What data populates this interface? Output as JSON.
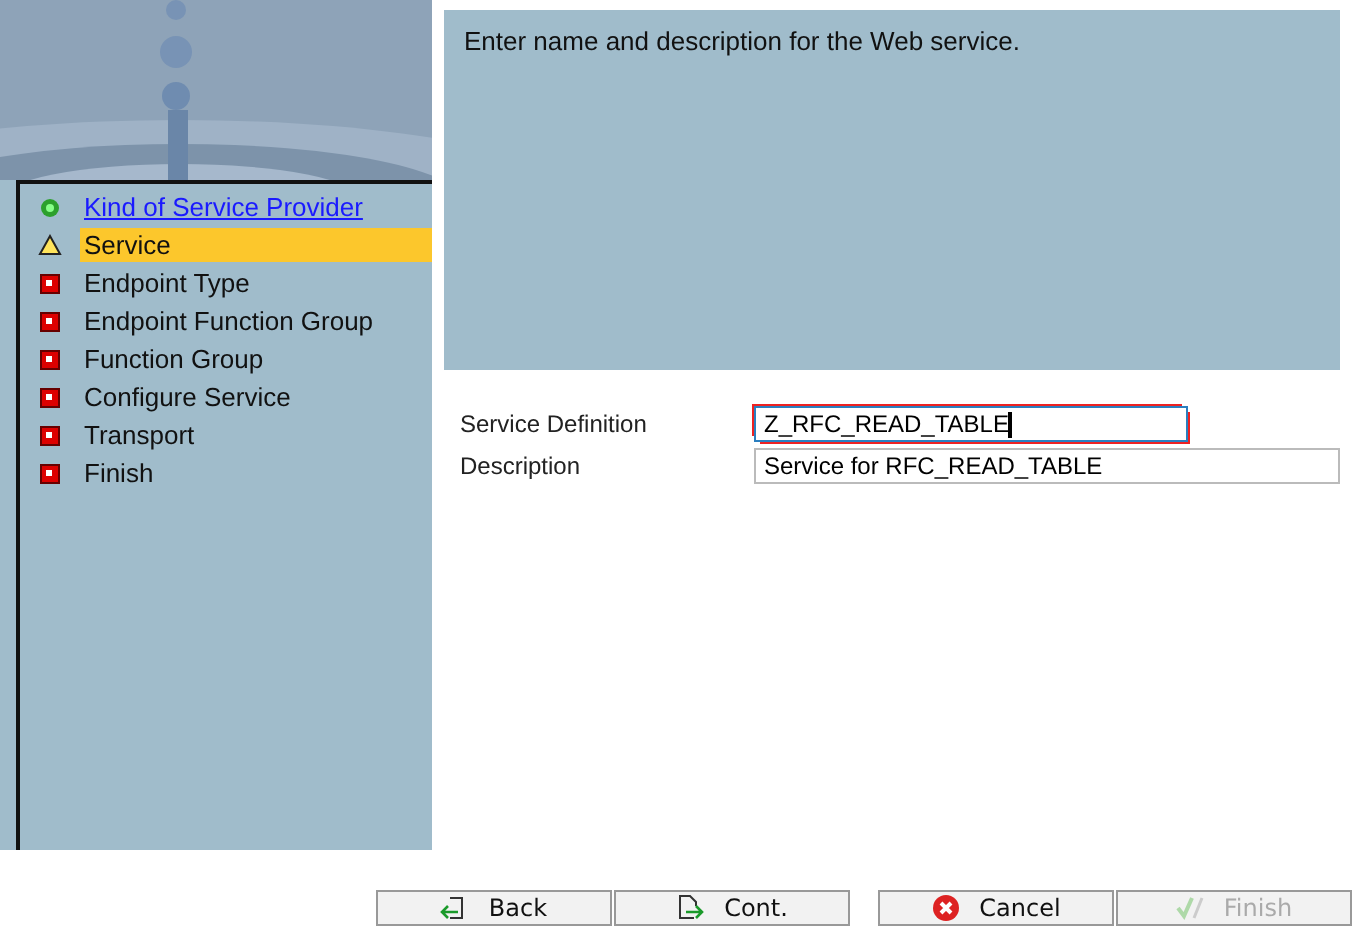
{
  "steps": [
    {
      "label": "Kind of Service Provider",
      "kind": "done",
      "selected": false
    },
    {
      "label": "Service",
      "kind": "current",
      "selected": true
    },
    {
      "label": "Endpoint Type",
      "kind": "todo",
      "selected": false
    },
    {
      "label": "Endpoint Function Group",
      "kind": "todo",
      "selected": false
    },
    {
      "label": "Function Group",
      "kind": "todo",
      "selected": false
    },
    {
      "label": "Configure Service",
      "kind": "todo",
      "selected": false
    },
    {
      "label": "Transport",
      "kind": "todo",
      "selected": false
    },
    {
      "label": "Finish",
      "kind": "todo",
      "selected": false
    }
  ],
  "info": "Enter name and description for the Web service.",
  "fields": [
    {
      "label": "Service Definition",
      "value": "Z_RFC_READ_TABLE",
      "focused": true
    },
    {
      "label": "Description",
      "value": "Service for RFC_READ_TABLE",
      "focused": false
    }
  ],
  "buttons": [
    {
      "kind": "back",
      "label": "Back",
      "disabled": false
    },
    {
      "kind": "cont",
      "label": "Cont.",
      "disabled": false
    },
    {
      "kind": "cancel",
      "label": "Cancel",
      "disabled": false
    },
    {
      "kind": "finish",
      "label": "Finish",
      "disabled": true
    }
  ]
}
